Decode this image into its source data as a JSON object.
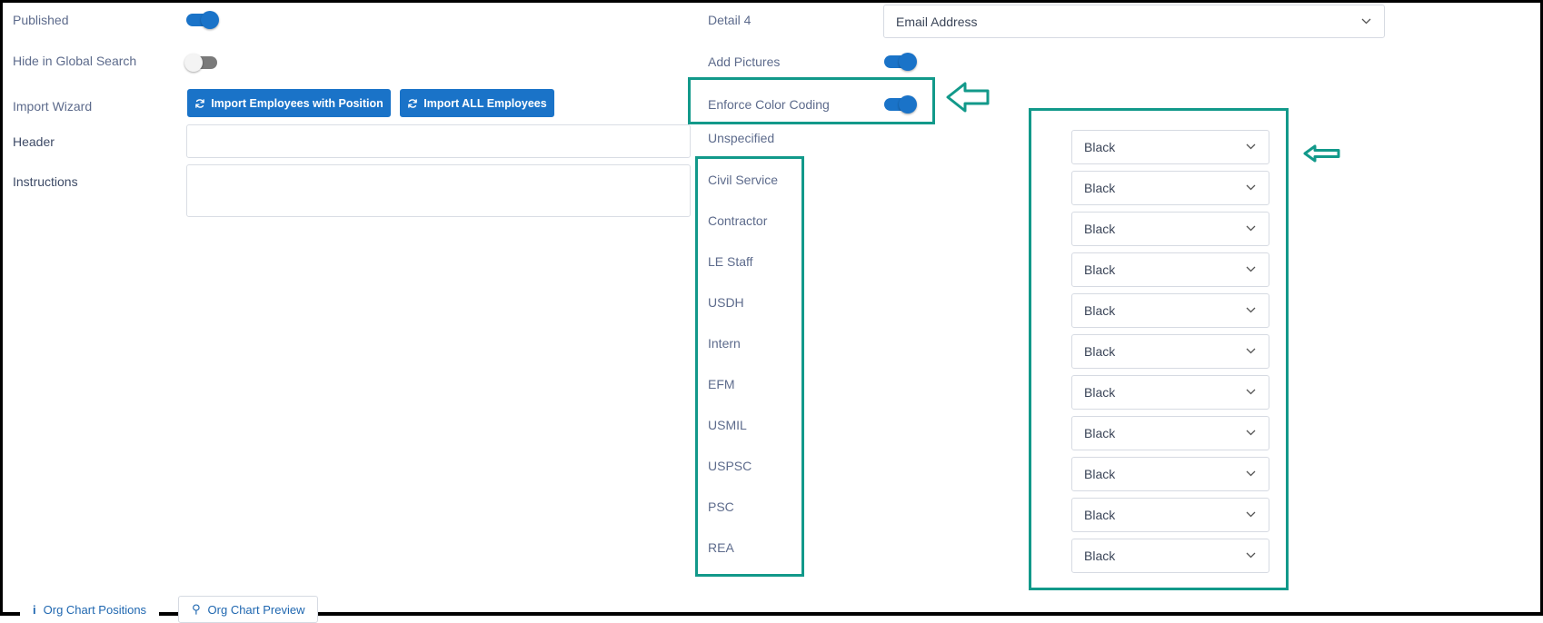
{
  "left_form": {
    "published_label": "Published",
    "hide_global_label": "Hide in Global Search",
    "import_wizard_label": "Import Wizard",
    "import_with_position": "Import Employees with Position",
    "import_all": "Import ALL Employees",
    "header_label": "Header",
    "instructions_label": "Instructions",
    "header_value": "",
    "instructions_value": ""
  },
  "right_form": {
    "detail4_label": "Detail 4",
    "detail4_value": "Email Address",
    "add_pictures_label": "Add Pictures",
    "enforce_color_label": "Enforce Color Coding",
    "unspecified_label": "Unspecified"
  },
  "toggles": {
    "published": true,
    "hide_global_search": false,
    "add_pictures": true,
    "enforce_color_coding": true
  },
  "categories": [
    "Civil Service",
    "Contractor",
    "LE Staff",
    "USDH",
    "Intern",
    "EFM",
    "USMIL",
    "USPSC",
    "PSC",
    "REA"
  ],
  "colors": [
    "Black",
    "Black",
    "Black",
    "Black",
    "Black",
    "Black",
    "Black",
    "Black",
    "Black",
    "Black",
    "Black"
  ],
  "bottom": {
    "tab1": "Org Chart Positions",
    "tab2": "Org Chart Preview"
  },
  "theme": {
    "accent": "#1a73c8",
    "highlight": "#12998a",
    "text": "#5d6b8c"
  }
}
